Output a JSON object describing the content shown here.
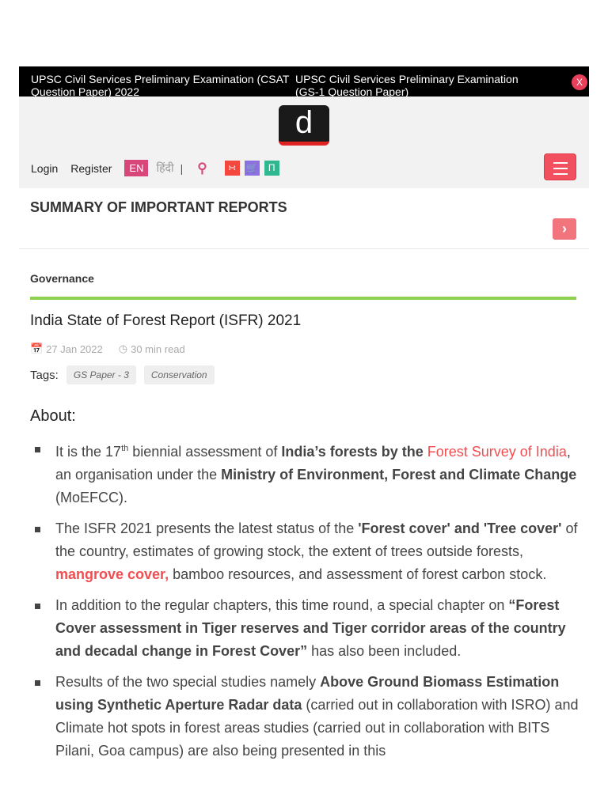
{
  "topbar": {
    "items": [
      "UPSC Civil Services Preliminary Examination (CSAT Question Paper) 2022",
      "UPSC Civil Services Preliminary Examination (GS-1 Question Paper)"
    ],
    "close": "X"
  },
  "header": {
    "logo": "d",
    "login": "Login",
    "register": "Register",
    "lang_en": "EN",
    "lang_hi": "हिंदी",
    "sep": "|"
  },
  "section_title": "SUMMARY OF IMPORTANT REPORTS",
  "article": {
    "category": "Governance",
    "title": "India State of Forest Report (ISFR) 2021",
    "date": "27 Jan 2022",
    "read_time": "30 min read",
    "tags_label": "Tags:",
    "tags": [
      "GS Paper - 3",
      "Conservation"
    ],
    "about": "About:",
    "bullets": [
      [
        {
          "t": "It is the 17"
        },
        {
          "t": "th",
          "s": "sup"
        },
        {
          "t": " biennial assessment of "
        },
        {
          "t": "India’s forests by the ",
          "s": "b"
        },
        {
          "t": "Forest Survey of India",
          "s": "red"
        },
        {
          "t": ", an organisation under the "
        },
        {
          "t": "Ministry of Environment, Forest and Climate Change",
          "s": "b"
        },
        {
          "t": " (MoEFCC)."
        }
      ],
      [
        {
          "t": "The ISFR 2021 presents the latest status of the "
        },
        {
          "t": "'Forest cover' and 'Tree cover'",
          "s": "b"
        },
        {
          "t": " of the country, estimates of growing stock, the extent of trees outside forests, "
        },
        {
          "t": "mangrove cover,",
          "s": "red b"
        },
        {
          "t": " bamboo resources, and assessment of forest carbon stock."
        }
      ],
      [
        {
          "t": "In addition to the regular chapters, this time round, a special chapter on "
        },
        {
          "t": "“Forest Cover assessment in Tiger reserves and Tiger corridor areas of the country and decadal change in Forest Cover”",
          "s": "b"
        },
        {
          "t": " has also been included."
        }
      ],
      [
        {
          "t": "Results of the two special studies namely "
        },
        {
          "t": "Above Ground Biomass Estimation using Synthetic Aperture Radar data",
          "s": "b"
        },
        {
          "t": " (carried out in collaboration with ISRO) and Climate hot spots in forest areas studies (carried out in collaboration with BITS Pilani, Goa campus) are also being presented in this"
        }
      ]
    ]
  }
}
